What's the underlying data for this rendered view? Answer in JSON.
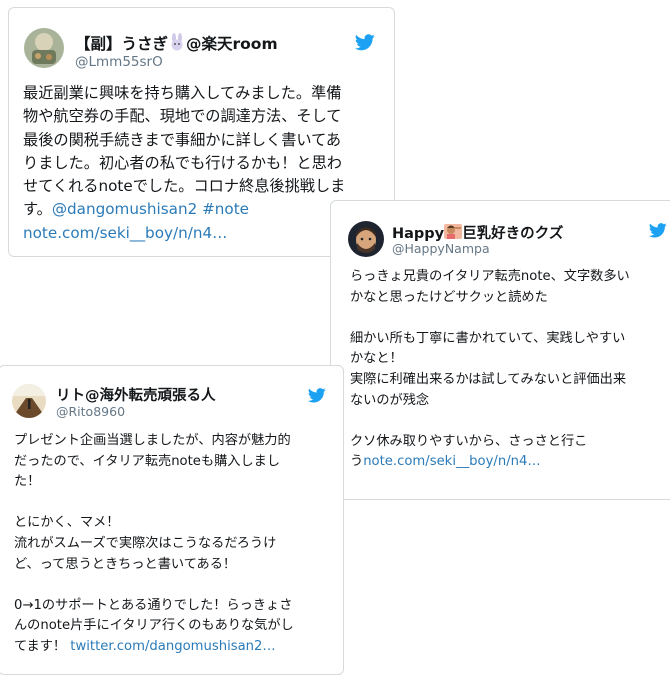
{
  "colors": {
    "link": "#2b7bb9",
    "handle": "#657786",
    "bird": "#1da1f2",
    "border": "#d6dadd"
  },
  "tweets": [
    {
      "name_prefix": "【副】うさぎ",
      "name_suffix": "@楽天room",
      "name_emoji": "rabbit-emoji",
      "handle": "@Lmm55srO",
      "lines": [
        "最近副業に興味を持ち購入してみました。準備",
        "物や航空券の手配、現地での調達方法、そして",
        "最後の関税手続きまで事細かに詳しく書いてあ",
        "りました。初心者の私でも行けるかも！と思わ",
        "せてくれるnoteでした。コロナ終息後挑戦しま",
        "す。"
      ],
      "mention": "@dangomushisan2",
      "hashtag": "#note",
      "link": "note.com/seki__boy/n/n4…"
    },
    {
      "name_prefix": "Happy",
      "name_suffix": "巨乳好きのクズ",
      "name_emoji": "person-emoji",
      "handle": "@HappyNampa",
      "lines": [
        "らっきょ兄貴のイタリア転売note、文字数多い",
        "かなと思ったけどサクッと読めた",
        "",
        "細かい所も丁寧に書かれていて、実践しやすい",
        "かなと！",
        "実際に利確出来るかは試してみないと評価出来",
        "ないのが残念",
        "",
        "クソ休み取りやすいから、さっさと行こ"
      ],
      "last_prefix": "う",
      "link": "note.com/seki__boy/n/n4…"
    },
    {
      "name": "リト@海外転売頑張る人",
      "handle": "@Rito8960",
      "lines": [
        "プレゼント企画当選しましたが、内容が魅力的",
        "だったので、イタリア転売noteも購入しまし",
        "た！",
        "",
        "とにかく、マメ！",
        "流れがスムーズで実際次はこうなるだろうけ",
        "ど、って思うときちっと書いてある！",
        "",
        "0→1のサポートとある通りでした！らっきょさ",
        "んのnote片手にイタリア行くのもありな気がし"
      ],
      "last_prefix": "てます！",
      "link": "twitter.com/dangomushisan2…"
    }
  ]
}
